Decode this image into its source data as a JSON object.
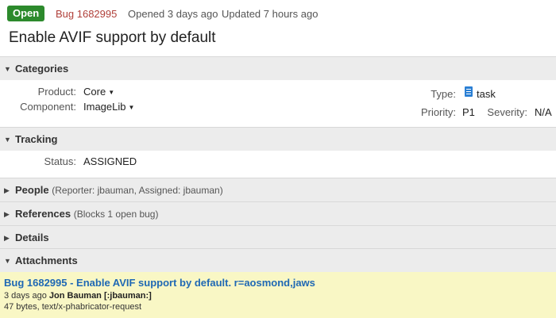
{
  "header": {
    "status": "Open",
    "bug_id": "Bug 1682995",
    "opened": "Opened 3 days ago",
    "updated": "Updated 7 hours ago",
    "summary": "Enable AVIF support by default"
  },
  "sections": {
    "categories": {
      "title": "Categories",
      "product_label": "Product:",
      "product_value": "Core",
      "component_label": "Component:",
      "component_value": "ImageLib",
      "type_label": "Type:",
      "type_value": "task",
      "priority_label": "Priority:",
      "priority_value": "P1",
      "severity_label": "Severity:",
      "severity_value": "N/A"
    },
    "tracking": {
      "title": "Tracking",
      "status_label": "Status:",
      "status_value": "ASSIGNED"
    },
    "people": {
      "title": "People",
      "meta": "(Reporter: jbauman, Assigned: jbauman)"
    },
    "references": {
      "title": "References",
      "meta": "(Blocks 1 open bug)"
    },
    "details": {
      "title": "Details"
    },
    "attachments": {
      "title": "Attachments",
      "item": {
        "title": "Bug 1682995 - Enable AVIF support by default. r=aosmond,jaws",
        "age": "3 days ago",
        "author": "Jon Bauman [:jbauman:]",
        "type": "47 bytes, text/x-phabricator-request"
      }
    }
  },
  "icons": {
    "expanded": "triangle-down",
    "collapsed": "triangle-right",
    "dropdown": "caret-down",
    "task": "clipboard-icon"
  },
  "colors": {
    "open_badge": "#2c8a2c",
    "bug_id": "#b0403a",
    "section_bg": "#ececec",
    "attachment_bg": "#f9f7c5",
    "link": "#1f68b4"
  }
}
